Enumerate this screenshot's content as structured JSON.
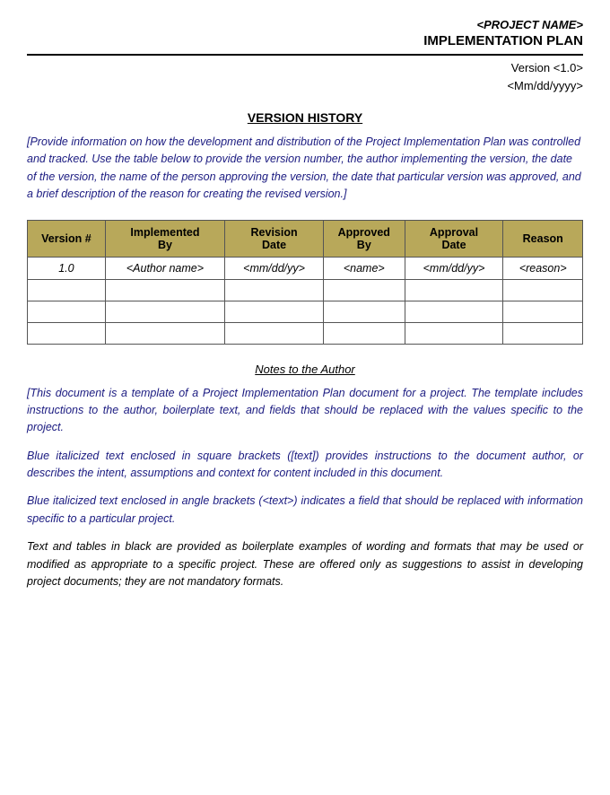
{
  "header": {
    "project_name": "<PROJECT NAME>",
    "doc_title": "IMPLEMENTATION PLAN",
    "version_label": "Version <1.0>",
    "date_label": "<Mm/dd/yyyy>"
  },
  "version_history": {
    "section_title": "VERSION HISTORY",
    "description": "[Provide information on how the development and distribution of the Project Implementation Plan was controlled and tracked.  Use the table below to provide the version number, the author implementing the version, the date of the version, the name of the person approving the version, the date that particular version was approved, and a brief description of the reason for creating the revised version.]",
    "table": {
      "headers": [
        "Version #",
        "Implemented By",
        "Revision Date",
        "Approved By",
        "Approval Date",
        "Reason"
      ],
      "rows": [
        [
          "1.0",
          "<Author name>",
          "<mm/dd/yy>",
          "<name>",
          "<mm/dd/yy>",
          "<reason>"
        ],
        [
          "",
          "",
          "",
          "",
          "",
          ""
        ],
        [
          "",
          "",
          "",
          "",
          "",
          ""
        ],
        [
          "",
          "",
          "",
          "",
          "",
          ""
        ]
      ]
    }
  },
  "notes": {
    "title": "Notes to the Author",
    "blocks": [
      "[This document is a template of a Project Implementation Plan document for a project.  The template includes instructions to the author, boilerplate text, and fields that should be replaced with the values specific to the project.",
      "Blue italicized text enclosed in square brackets ([text]) provides instructions to the document author, or describes the intent, assumptions and context for content included in this document.",
      "Blue italicized text enclosed in angle brackets (<text>) indicates a field that should be replaced with information specific to a particular project.",
      "Text and tables in black are provided as boilerplate examples of wording and formats that may be used or modified as appropriate to a specific project.  These are offered only as suggestions to assist in developing project documents; they are not mandatory formats."
    ]
  }
}
